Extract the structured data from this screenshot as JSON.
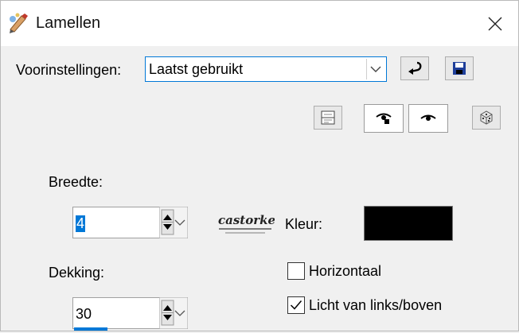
{
  "window": {
    "title": "Lamellen",
    "app_icon": "paint-app-icon",
    "close_icon": "close-icon"
  },
  "presets": {
    "label": "Voorinstellingen:",
    "selected": "Laatst gebruikt",
    "dropdown_icon": "chevron-down-icon",
    "reset_icon": "reset-arrow-icon",
    "save_icon": "floppy-disk-icon"
  },
  "toolbar": {
    "icons": [
      "randomize-settings-icon",
      "proof-preview-icon",
      "auto-proof-eye-icon",
      "dice-icon"
    ]
  },
  "width_field": {
    "label": "Breedte:",
    "value": "4"
  },
  "opacity_field": {
    "label": "Dekking:",
    "value": "30"
  },
  "color": {
    "label": "Kleur:",
    "value": "#000000"
  },
  "options": {
    "horizontal": {
      "label": "Horizontaal",
      "checked": false
    },
    "light_from": {
      "label": "Licht van links/boven",
      "checked": true
    }
  },
  "logo_text": "castorke",
  "colors": {
    "accent": "#0078d7",
    "background": "#f0f0f0",
    "titlebar": "#ffffff"
  }
}
